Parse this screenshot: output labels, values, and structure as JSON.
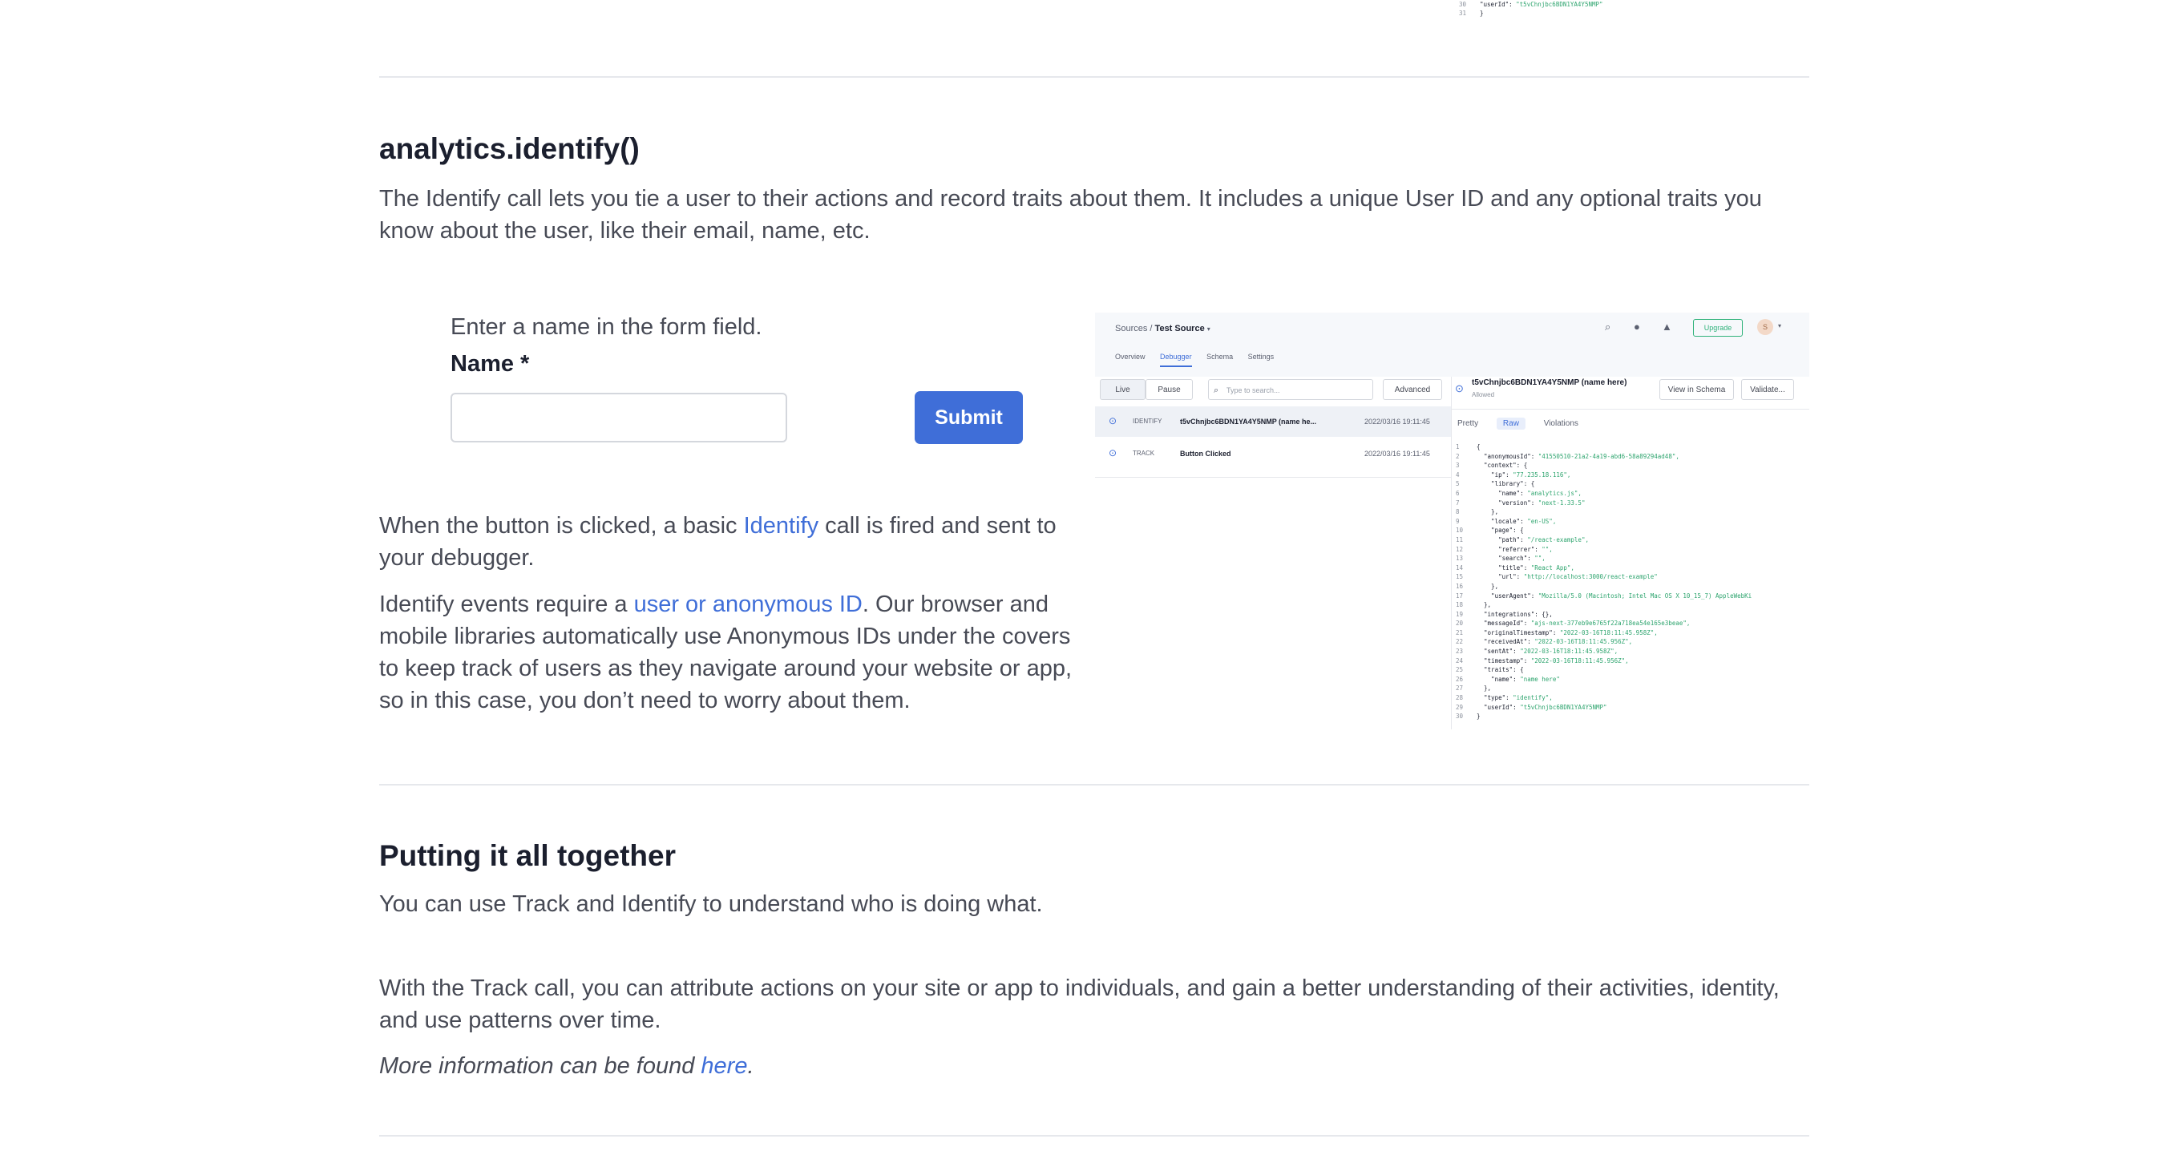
{
  "top_snippet": [
    {
      "n": "30",
      "key": "\"userId\": ",
      "val": "\"t5vChnjbc6BDN1YA4Y5NMP\""
    },
    {
      "n": "31",
      "key": "}",
      "val": ""
    }
  ],
  "identify_section": {
    "heading": "analytics.identify()",
    "intro": "The Identify call lets you tie a user to their actions and record traits about them. It includes a unique User ID and any optional traits you know about the user, like their email, name, etc.",
    "form": {
      "hint": "Enter a name in the form field.",
      "label": "Name *",
      "input_value": "",
      "submit_label": "Submit"
    },
    "para1_before": "When the button is clicked, a basic ",
    "para1_link": "Identify",
    "para1_after": " call is fired and sent to your debugger.",
    "para2_before": "Identify events require a ",
    "para2_link": "user or anonymous ID",
    "para2_after": ". Our browser and mobile libraries automatically use Anonymous IDs under the covers to keep track of users as they navigate around your website or app, so in this case, you don’t need to worry about them."
  },
  "debugger": {
    "breadcrumb_root": "Sources",
    "breadcrumb_sep": "/",
    "breadcrumb_current": "Test Source",
    "tabs": [
      "Overview",
      "Debugger",
      "Schema",
      "Settings"
    ],
    "upgrade_label": "Upgrade",
    "avatar_initial": "S",
    "live_label": "Live",
    "pause_label": "Pause",
    "search_placeholder": "Type to search...",
    "advanced_label": "Advanced",
    "events": [
      {
        "type": "IDENTIFY",
        "name": "t5vChnjbc6BDN1YA4Y5NMP (name he...",
        "time": "2022/03/16 19:11:45"
      },
      {
        "type": "TRACK",
        "name": "Button Clicked",
        "time": "2022/03/16 19:11:45"
      }
    ],
    "detail_title": "t5vChnjbc6BDN1YA4Y5NMP (name here)",
    "detail_status": "Allowed",
    "view_schema_label": "View in Schema",
    "validate_label": "Validate...",
    "raw_tabs": [
      "Pretty",
      "Raw",
      "Violations"
    ],
    "code_lines": [
      {
        "n": "1",
        "key": "{",
        "val": ""
      },
      {
        "n": "2",
        "key": "  \"anonymousId\": ",
        "val": "\"41550510-21a2-4a19-abd6-58a89294ad48\","
      },
      {
        "n": "3",
        "key": "  \"context\": {",
        "val": ""
      },
      {
        "n": "4",
        "key": "    \"ip\": ",
        "val": "\"77.235.18.116\","
      },
      {
        "n": "5",
        "key": "    \"library\": {",
        "val": ""
      },
      {
        "n": "6",
        "key": "      \"name\": ",
        "val": "\"analytics.js\","
      },
      {
        "n": "7",
        "key": "      \"version\": ",
        "val": "\"next-1.33.5\""
      },
      {
        "n": "8",
        "key": "    },",
        "val": ""
      },
      {
        "n": "9",
        "key": "    \"locale\": ",
        "val": "\"en-US\","
      },
      {
        "n": "10",
        "key": "    \"page\": {",
        "val": ""
      },
      {
        "n": "11",
        "key": "      \"path\": ",
        "val": "\"/react-example\","
      },
      {
        "n": "12",
        "key": "      \"referrer\": ",
        "val": "\"\","
      },
      {
        "n": "13",
        "key": "      \"search\": ",
        "val": "\"\","
      },
      {
        "n": "14",
        "key": "      \"title\": ",
        "val": "\"React App\","
      },
      {
        "n": "15",
        "key": "      \"url\": ",
        "val": "\"http://localhost:3000/react-example\""
      },
      {
        "n": "16",
        "key": "    },",
        "val": ""
      },
      {
        "n": "17",
        "key": "    \"userAgent\": ",
        "val": "\"Mozilla/5.0 (Macintosh; Intel Mac OS X 10_15_7) AppleWebKi"
      },
      {
        "n": "18",
        "key": "  },",
        "val": ""
      },
      {
        "n": "19",
        "key": "  \"integrations\": {},",
        "val": ""
      },
      {
        "n": "20",
        "key": "  \"messageId\": ",
        "val": "\"ajs-next-377eb9e6765f22a718ea54e165e3beae\","
      },
      {
        "n": "21",
        "key": "  \"originalTimestamp\": ",
        "val": "\"2022-03-16T18:11:45.958Z\","
      },
      {
        "n": "22",
        "key": "  \"receivedAt\": ",
        "val": "\"2022-03-16T18:11:45.956Z\","
      },
      {
        "n": "23",
        "key": "  \"sentAt\": ",
        "val": "\"2022-03-16T18:11:45.958Z\","
      },
      {
        "n": "24",
        "key": "  \"timestamp\": ",
        "val": "\"2022-03-16T18:11:45.956Z\","
      },
      {
        "n": "25",
        "key": "  \"traits\": {",
        "val": ""
      },
      {
        "n": "26",
        "key": "    \"name\": ",
        "val": "\"name here\""
      },
      {
        "n": "27",
        "key": "  },",
        "val": ""
      },
      {
        "n": "28",
        "key": "  \"type\": ",
        "val": "\"identify\","
      },
      {
        "n": "29",
        "key": "  \"userId\": ",
        "val": "\"t5vChnjbc6BDN1YA4Y5NMP\""
      },
      {
        "n": "30",
        "key": "}",
        "val": ""
      }
    ]
  },
  "together_section": {
    "heading": "Putting it all together",
    "p1": "You can use Track and Identify to understand who is doing what.",
    "p2": "With the Track call, you can attribute actions on your site or app to individuals, and gain a better understanding of their activities, identity, and use patterns over time.",
    "p3_before": "More information can be found ",
    "p3_link": "here",
    "p3_after": "."
  }
}
